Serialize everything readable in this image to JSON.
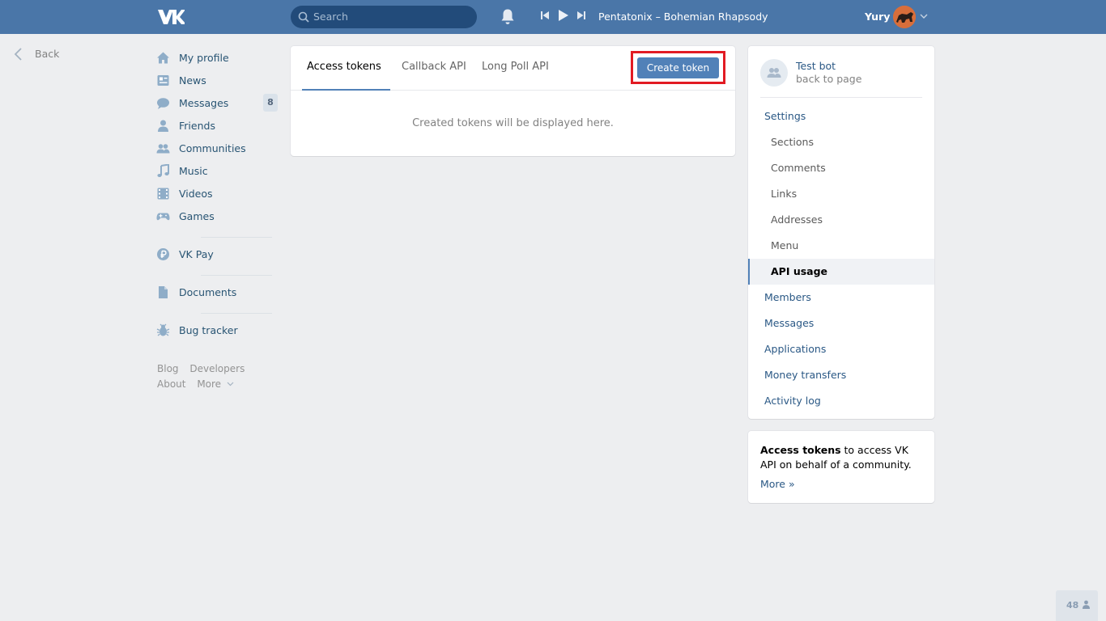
{
  "header": {
    "logo": "VK",
    "search_placeholder": "Search",
    "now_playing": "Pentatonix – Bohemian Rhapsody",
    "user_name": "Yury"
  },
  "back": {
    "label": "Back"
  },
  "leftnav": {
    "items": [
      {
        "label": "My profile",
        "icon": "home-icon"
      },
      {
        "label": "News",
        "icon": "news-icon"
      },
      {
        "label": "Messages",
        "icon": "messages-icon",
        "badge": "8"
      },
      {
        "label": "Friends",
        "icon": "user-icon"
      },
      {
        "label": "Communities",
        "icon": "users-icon"
      },
      {
        "label": "Music",
        "icon": "music-icon"
      },
      {
        "label": "Videos",
        "icon": "film-icon"
      },
      {
        "label": "Games",
        "icon": "gamepad-icon"
      }
    ],
    "vkpay": "VK Pay",
    "documents": "Documents",
    "bugtracker": "Bug tracker",
    "footer": {
      "blog": "Blog",
      "developers": "Developers",
      "about": "About",
      "more": "More"
    }
  },
  "main": {
    "tabs": [
      {
        "label": "Access tokens",
        "active": true
      },
      {
        "label": "Callback API"
      },
      {
        "label": "Long Poll API"
      }
    ],
    "create_button": "Create token",
    "empty_message": "Created tokens will be displayed here."
  },
  "right": {
    "group_name": "Test bot",
    "group_sub": "back to page",
    "menu": {
      "settings": "Settings",
      "sections": "Sections",
      "comments": "Comments",
      "links": "Links",
      "addresses": "Addresses",
      "menu": "Menu",
      "api_usage": "API usage",
      "members": "Members",
      "messages": "Messages",
      "applications": "Applications",
      "money_transfers": "Money transfers",
      "activity_log": "Activity log"
    },
    "info": {
      "bold": "Access tokens",
      "rest": " to access VK API on behalf of a community.",
      "more": "More »"
    }
  },
  "online_count": "48",
  "colors": {
    "header": "#4a76a8",
    "accent": "#5181b8",
    "highlight_border": "#e21b23",
    "background": "#edeef0"
  }
}
